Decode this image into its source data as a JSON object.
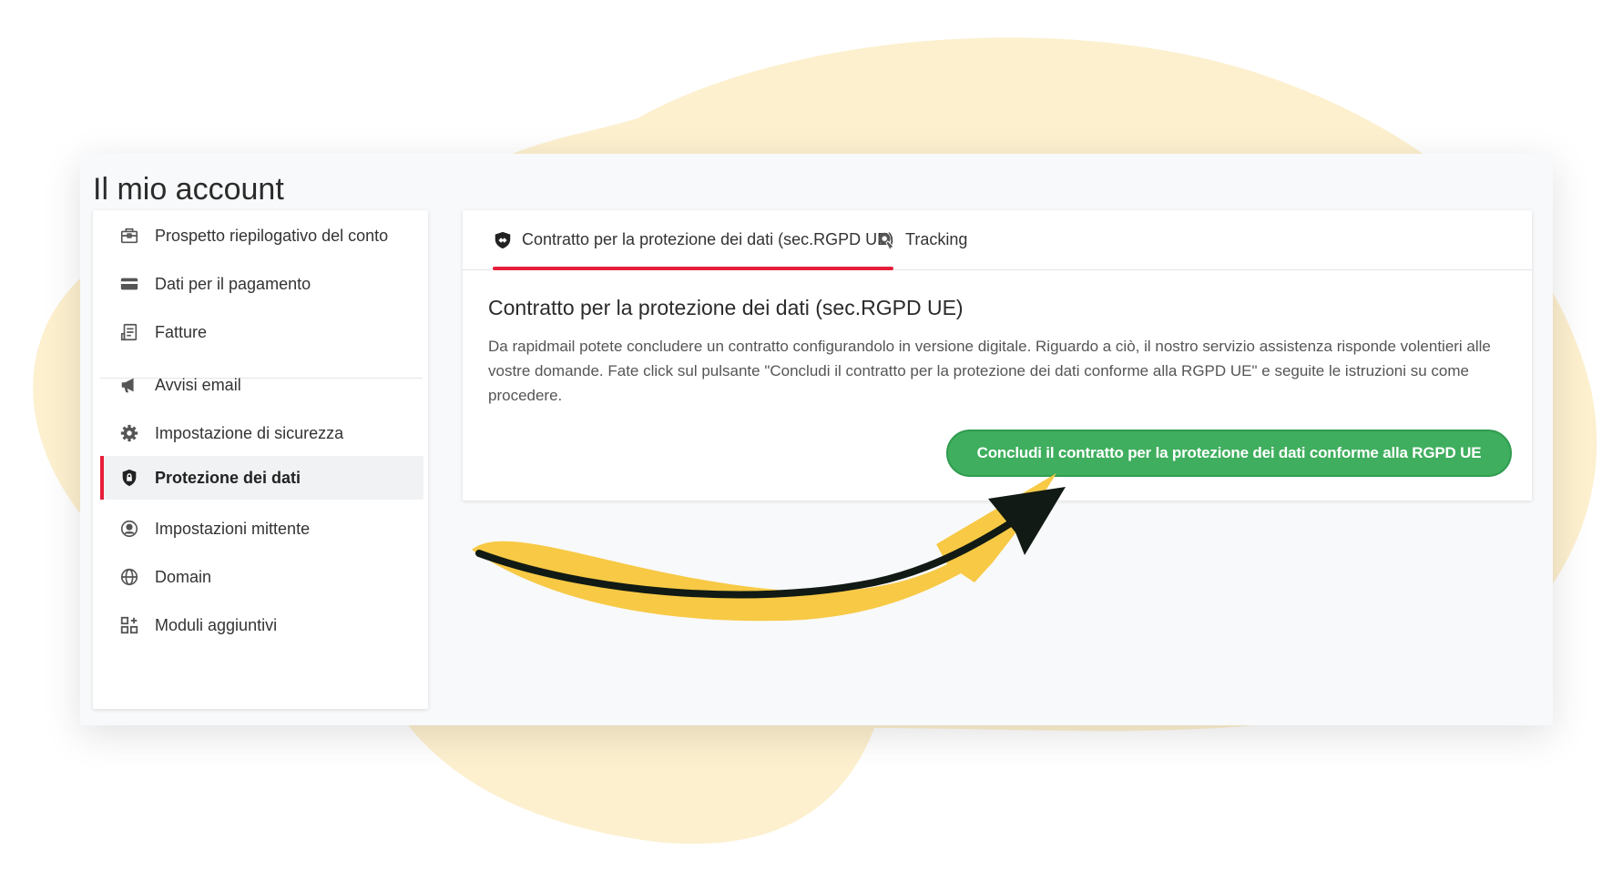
{
  "page": {
    "title": "Il mio account"
  },
  "sidebar": {
    "items": [
      {
        "label": "Prospetto riepilogativo del conto",
        "icon": "briefcase-icon"
      },
      {
        "label": "Dati per il pagamento",
        "icon": "credit-card-icon"
      },
      {
        "label": "Fatture",
        "icon": "invoice-icon"
      },
      {
        "label": "Avvisi email",
        "icon": "megaphone-icon"
      },
      {
        "label": "Impostazione di sicurezza",
        "icon": "gear-icon"
      },
      {
        "label": "Protezione dei dati",
        "icon": "shield-lock-icon",
        "active": true
      },
      {
        "label": "Impostazioni mittente",
        "icon": "user-circle-icon"
      },
      {
        "label": "Domain",
        "icon": "globe-icon"
      },
      {
        "label": "Moduli aggiuntivi",
        "icon": "modules-icon"
      }
    ]
  },
  "tabs": [
    {
      "label": "Contratto per la protezione dei dati (sec.RGPD UE)",
      "icon": "handshake-icon",
      "active": true
    },
    {
      "label": "Tracking",
      "icon": "tracking-icon"
    }
  ],
  "content": {
    "title": "Contratto per la protezione dei dati (sec.RGPD UE)",
    "text": "Da rapidmail potete concludere un contratto configurandolo in versione digitale. Riguardo a ciò, il nostro servizio assistenza risponde volentieri alle vostre domande. Fate click sul pulsante \"Concludi il contratto per la protezione dei dati conforme alla RGPD UE\" e seguite le istruzioni su come procedere.",
    "button_label": "Concludi il contratto per la protezione dei dati conforme alla RGPD UE"
  },
  "colors": {
    "accent": "#e6203a",
    "button": "#3fae5e",
    "blob": "#fdf0cf",
    "arrow_fill": "#f7c945",
    "arrow_stroke": "#111a14"
  }
}
